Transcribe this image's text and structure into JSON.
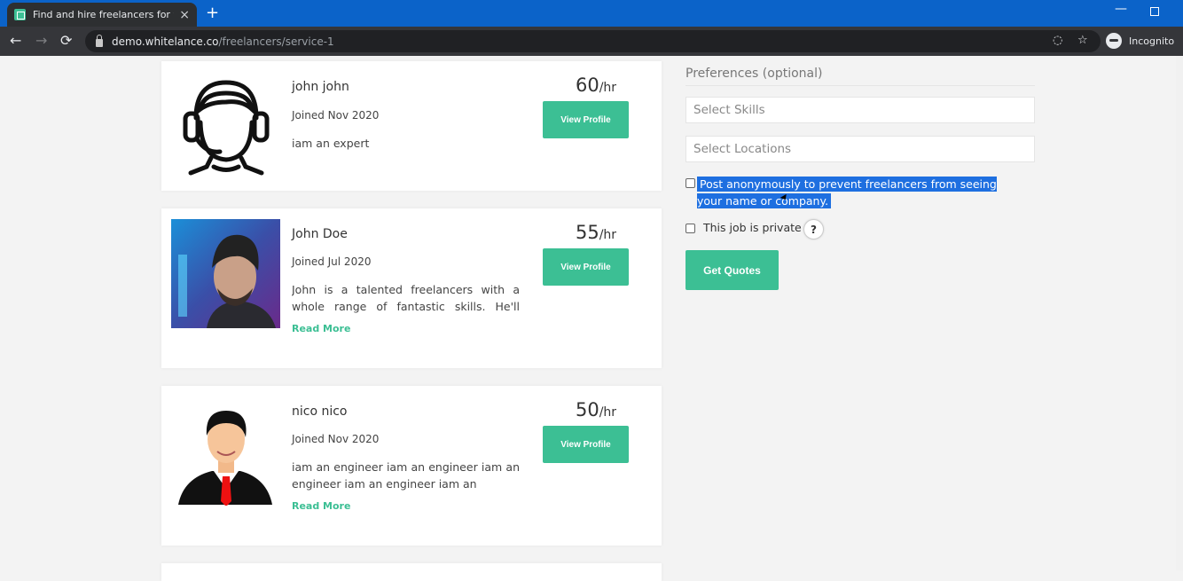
{
  "browser": {
    "tab_title": "Find and hire freelancers for your",
    "tab_close": "×",
    "new_tab": "+",
    "url_host": "demo.whitelance.co",
    "url_path": "/freelancers/service-1",
    "incognito_label": "Incognito",
    "minimize": "—",
    "back": "←",
    "forward": "→",
    "reload": "⟳",
    "eye_off": "◌",
    "star": "☆"
  },
  "freelancers": [
    {
      "name": "john john",
      "joined": "Joined Nov 2020",
      "description": "iam an expert",
      "rate": "60",
      "rate_unit": "/hr",
      "button": "View Profile",
      "avatar_icon": "headset-avatar-icon"
    },
    {
      "name": "John Doe",
      "joined": "Joined Jul 2020",
      "description": "John is a talented freelancers with a whole range of fantastic skills. He'll solve",
      "read_more": "Read More",
      "rate": "55",
      "rate_unit": "/hr",
      "button": "View Profile",
      "avatar_icon": "photo-avatar-icon"
    },
    {
      "name": "nico nico",
      "joined": "Joined Nov 2020",
      "description": "iam an engineer iam an engineer iam an engineer iam an engineer iam an",
      "read_more": "Read More",
      "rate": "50",
      "rate_unit": "/hr",
      "button": "View Profile",
      "avatar_icon": "businessman-avatar-icon"
    }
  ],
  "preferences": {
    "title": "Preferences (optional)",
    "skills_placeholder": "Select Skills",
    "locations_placeholder": "Select Locations",
    "anonymous_label": "Post anonymously to prevent freelancers from seeing your name or company.",
    "private_label": "This job is private",
    "help": "?",
    "quotes_button": "Get Quotes"
  },
  "colors": {
    "accent": "#3cbf94",
    "chrome_blue": "#0b63c9",
    "selection": "#1e6fe0"
  }
}
